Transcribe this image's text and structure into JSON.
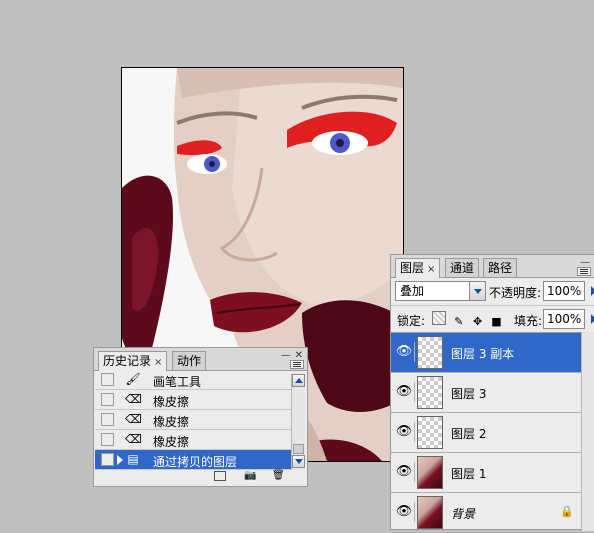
{
  "layers_panel": {
    "tabs": [
      {
        "label": "图层",
        "active": true,
        "close": "×"
      },
      {
        "label": "通道",
        "active": false
      },
      {
        "label": "路径",
        "active": false
      }
    ],
    "blend_mode": "叠加",
    "opacity_label": "不透明度:",
    "opacity_value": "100%",
    "lock_label": "锁定:",
    "fill_label": "填充:",
    "fill_value": "100%",
    "layers": [
      {
        "name": "图层 3 副本",
        "visible": true,
        "selected": true,
        "thumb": "transparent"
      },
      {
        "name": "图层 3",
        "visible": true,
        "selected": false,
        "thumb": "transparent"
      },
      {
        "name": "图层 2",
        "visible": true,
        "selected": false,
        "thumb": "transparent"
      },
      {
        "name": "图层 1",
        "visible": true,
        "selected": false,
        "thumb": "photo"
      },
      {
        "name": "背景",
        "visible": true,
        "selected": false,
        "thumb": "photo",
        "locked": true
      }
    ]
  },
  "history_panel": {
    "tabs": [
      {
        "label": "历史记录",
        "active": true,
        "close": "×"
      },
      {
        "label": "动作",
        "active": false
      }
    ],
    "items": [
      {
        "label": "画笔工具",
        "icon": "brush-icon"
      },
      {
        "label": "橡皮擦",
        "icon": "eraser-icon"
      },
      {
        "label": "橡皮擦",
        "icon": "eraser-icon"
      },
      {
        "label": "橡皮擦",
        "icon": "eraser-icon"
      },
      {
        "label": "通过拷贝的图层",
        "icon": "layer-copy-icon",
        "selected": true
      }
    ]
  },
  "colors": {
    "selection": "#3168c7",
    "panel_bg": "#ececec",
    "workspace": "#c0c0c0"
  }
}
